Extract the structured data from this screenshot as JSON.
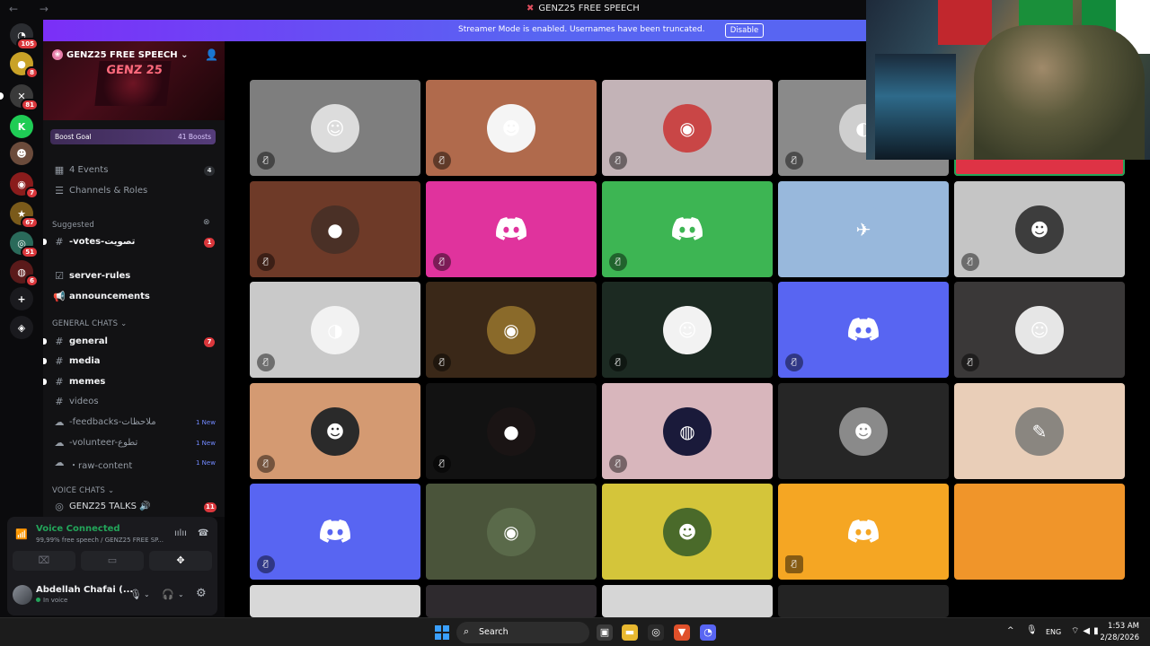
{
  "window": {
    "title": "GENZ25 FREE SPEECH",
    "nav_icons": "← →"
  },
  "banner": {
    "text": "Streamer Mode is enabled. Usernames have been truncated.",
    "button": "Disable"
  },
  "server_rail": [
    {
      "name": "discord-home",
      "glyph": "◔",
      "badge": "105",
      "color": "#2b2d31"
    },
    {
      "name": "server-a",
      "glyph": "●",
      "badge": "8",
      "color": "#c9a227"
    },
    {
      "name": "server-b",
      "glyph": "✕",
      "badge": "81",
      "color": "#3a3a3a"
    },
    {
      "name": "server-k",
      "glyph": "K",
      "badge": "",
      "color": "#1fcc55"
    },
    {
      "name": "server-c",
      "glyph": "☻",
      "badge": "",
      "color": "#6b4b3b"
    },
    {
      "name": "server-d",
      "glyph": "◉",
      "badge": "7",
      "color": "#8a1c1c"
    },
    {
      "name": "server-e",
      "glyph": "★",
      "badge": "67",
      "color": "#7a5a1a"
    },
    {
      "name": "server-f",
      "glyph": "◎",
      "badge": "51",
      "color": "#2a6a5a"
    },
    {
      "name": "server-g",
      "glyph": "◍",
      "badge": "6",
      "color": "#5a1a1a"
    },
    {
      "name": "add-server",
      "glyph": "+",
      "badge": "",
      "color": "#1a1a1e"
    },
    {
      "name": "discover",
      "glyph": "◈",
      "badge": "",
      "color": "#1a1a1e"
    }
  ],
  "server": {
    "name": "GENZ25 FREE SPEECH",
    "banner_art": "GENZ 25",
    "boost_label": "Boost Goal",
    "boost_count": "41 Boosts"
  },
  "channels": {
    "events": {
      "label": "4 Events",
      "count": "4"
    },
    "channels_roles": "Channels & Roles",
    "suggested_header": "Suggested",
    "votes": {
      "label": "-votes-تصويت",
      "count": "1"
    },
    "server_rules": "server-rules",
    "announcements": "announcements",
    "general_header": "GENERAL CHATS",
    "general": {
      "label": "general",
      "count": "7"
    },
    "media": "media",
    "memes": "memes",
    "videos": "videos",
    "feedbacks": {
      "label": "-feedbacks-ملاحظات",
      "new": "1 New"
    },
    "volunteer": {
      "label": "-volunteer-تطوع",
      "new": "1 New"
    },
    "raw_content": {
      "label": "・raw-content",
      "new": "1 New"
    },
    "voice_header": "VOICE CHATS",
    "voice_channel": {
      "label": "GENZ25 TALKS 🔊",
      "count": "11"
    }
  },
  "voice_panel": {
    "status": "Voice Connected",
    "channel": "99,99% free speech / GENZ25 FREE SP...",
    "user_name": "Abdellah Chafai (...",
    "user_status": "In voice"
  },
  "tiles": [
    {
      "bg": "#7e7e7e",
      "av_bg": "#dcdcdc",
      "glyph": "☺",
      "discord": false,
      "mute": "slash",
      "speaking": false
    },
    {
      "bg": "#b06a4c",
      "av_bg": "#f5f5f5",
      "glyph": "☻",
      "discord": false,
      "mute": "slash",
      "speaking": false
    },
    {
      "bg": "#c3b3b7",
      "av_bg": "#c94646",
      "glyph": "◉",
      "discord": false,
      "mute": "slash",
      "speaking": false
    },
    {
      "bg": "#8a8a8a",
      "av_bg": "#cfcfcf",
      "glyph": "◐",
      "discord": false,
      "mute": "slash",
      "speaking": false
    },
    {
      "bg": "#de3345",
      "av_bg": "",
      "glyph": "",
      "discord": true,
      "mute": "",
      "speaking": true
    },
    {
      "bg": "#6e3a28",
      "av_bg": "#4a3026",
      "glyph": "●",
      "discord": false,
      "mute": "slash",
      "speaking": false
    },
    {
      "bg": "#e0339d",
      "av_bg": "",
      "glyph": "",
      "discord": true,
      "mute": "slash",
      "speaking": false
    },
    {
      "bg": "#3db553",
      "av_bg": "",
      "glyph": "",
      "discord": true,
      "mute": "slash",
      "speaking": false
    },
    {
      "bg": "#98b8dc",
      "av_bg": "#98b8dc",
      "glyph": "✈",
      "discord": false,
      "mute": "",
      "speaking": false
    },
    {
      "bg": "#c5c5c5",
      "av_bg": "#3d3d3d",
      "glyph": "☻",
      "discord": false,
      "mute": "slash",
      "speaking": false
    },
    {
      "bg": "#c9c9c9",
      "av_bg": "#f2f2f2",
      "glyph": "◑",
      "discord": false,
      "mute": "slash",
      "speaking": false
    },
    {
      "bg": "#3a2818",
      "av_bg": "#8a6a2a",
      "glyph": "◉",
      "discord": false,
      "mute": "slash",
      "speaking": false
    },
    {
      "bg": "#1c2a22",
      "av_bg": "#f2f2f2",
      "glyph": "☺",
      "discord": false,
      "mute": "slash",
      "speaking": false
    },
    {
      "bg": "#5865f2",
      "av_bg": "",
      "glyph": "",
      "discord": true,
      "mute": "slash",
      "speaking": false
    },
    {
      "bg": "#3a3838",
      "av_bg": "#e6e6e6",
      "glyph": "☺",
      "discord": false,
      "mute": "slash",
      "speaking": false
    },
    {
      "bg": "#d49a72",
      "av_bg": "#2a2a2a",
      "glyph": "☻",
      "discord": false,
      "mute": "slash",
      "speaking": false
    },
    {
      "bg": "#121212",
      "av_bg": "#1a1414",
      "glyph": "●",
      "discord": false,
      "mute": "slash",
      "speaking": false
    },
    {
      "bg": "#d8b6bc",
      "av_bg": "#1a1a3a",
      "glyph": "◍",
      "discord": false,
      "mute": "slash",
      "speaking": false
    },
    {
      "bg": "#262626",
      "av_bg": "#8a8a8a",
      "glyph": "☻",
      "discord": false,
      "mute": "",
      "speaking": false
    },
    {
      "bg": "#e9ceb8",
      "av_bg": "#8a8680",
      "glyph": "✎",
      "discord": false,
      "mute": "",
      "speaking": false
    },
    {
      "bg": "#5865f2",
      "av_bg": "",
      "glyph": "",
      "discord": true,
      "mute": "slash",
      "speaking": false
    },
    {
      "bg": "#4a543a",
      "av_bg": "#5a6a4a",
      "glyph": "◉",
      "discord": false,
      "mute": "",
      "speaking": false
    },
    {
      "bg": "#d4c53a",
      "av_bg": "#4a6a2a",
      "glyph": "☻",
      "discord": false,
      "mute": "",
      "speaking": false
    },
    {
      "bg": "#f5a623",
      "av_bg": "",
      "glyph": "",
      "discord": true,
      "mute": "square",
      "speaking": false
    },
    {
      "bg": "#f0952a",
      "av_bg": "",
      "glyph": "",
      "discord": false,
      "mute": "",
      "speaking": false
    },
    {
      "bg": "#d8d8d8",
      "av_bg": "",
      "glyph": "",
      "discord": false,
      "mute": "",
      "speaking": false
    },
    {
      "bg": "#2e2a2e",
      "av_bg": "",
      "glyph": "",
      "discord": false,
      "mute": "",
      "speaking": false
    },
    {
      "bg": "#d6d6d6",
      "av_bg": "",
      "glyph": "",
      "discord": false,
      "mute": "",
      "speaking": false
    },
    {
      "bg": "#232323",
      "av_bg": "",
      "glyph": "",
      "discord": false,
      "mute": "",
      "speaking": false
    }
  ],
  "taskbar": {
    "search": "Search",
    "language": "ENG",
    "time": "1:53 AM",
    "date": "2/28/2026"
  }
}
